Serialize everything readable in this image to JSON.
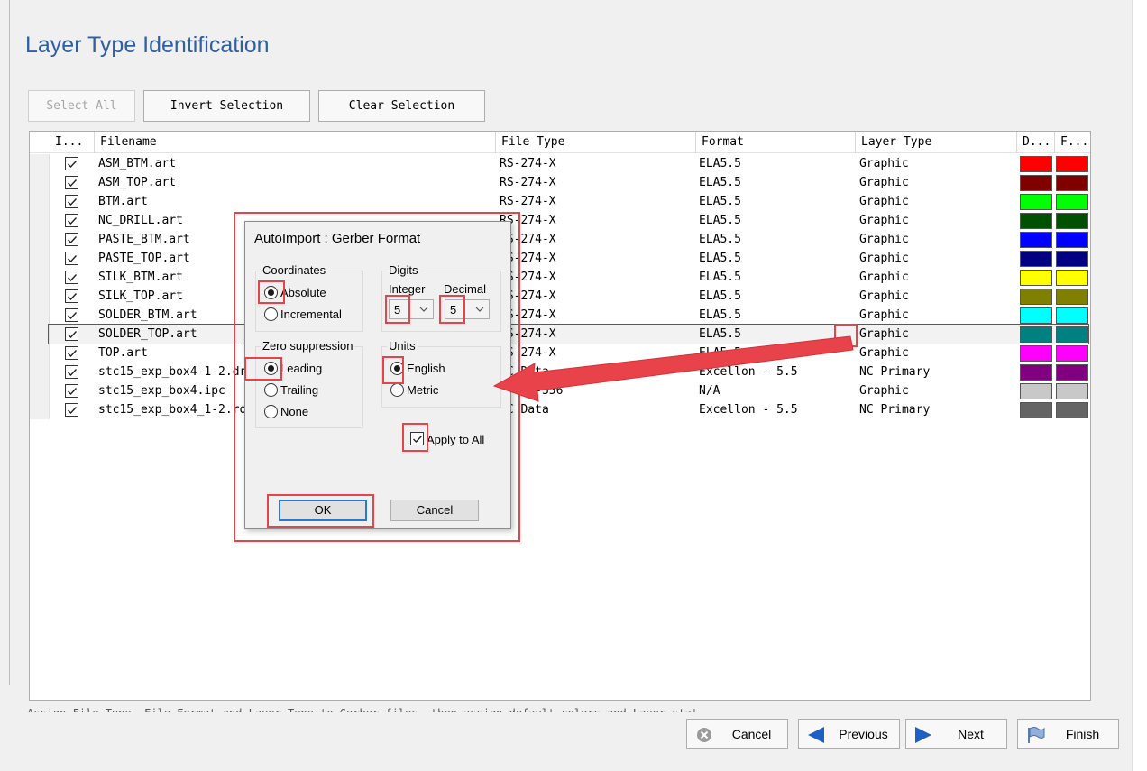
{
  "page_title": "Layer Type Identification",
  "toolbar": {
    "select_all": "Select All",
    "invert_selection": "Invert Selection",
    "clear_selection": "Clear Selection"
  },
  "columns": [
    "I...",
    "Filename",
    "File Type",
    "Format",
    "Layer Type",
    "D...",
    "F..."
  ],
  "rows": [
    {
      "filename": "ASM_BTM.art",
      "file_type": "RS-274-X",
      "format": "ELA5.5",
      "layer_type": "Graphic",
      "color": "#ff0000"
    },
    {
      "filename": "ASM_TOP.art",
      "file_type": "RS-274-X",
      "format": "ELA5.5",
      "layer_type": "Graphic",
      "color": "#800000"
    },
    {
      "filename": "BTM.art",
      "file_type": "RS-274-X",
      "format": "ELA5.5",
      "layer_type": "Graphic",
      "color": "#00ff00"
    },
    {
      "filename": "NC_DRILL.art",
      "file_type": "RS-274-X",
      "format": "ELA5.5",
      "layer_type": "Graphic",
      "color": "#005000"
    },
    {
      "filename": "PASTE_BTM.art",
      "file_type": "RS-274-X",
      "format": "ELA5.5",
      "layer_type": "Graphic",
      "color": "#0000ff"
    },
    {
      "filename": "PASTE_TOP.art",
      "file_type": "RS-274-X",
      "format": "ELA5.5",
      "layer_type": "Graphic",
      "color": "#000080"
    },
    {
      "filename": "SILK_BTM.art",
      "file_type": "RS-274-X",
      "format": "ELA5.5",
      "layer_type": "Graphic",
      "color": "#ffff00"
    },
    {
      "filename": "SILK_TOP.art",
      "file_type": "RS-274-X",
      "format": "ELA5.5",
      "layer_type": "Graphic",
      "color": "#808000"
    },
    {
      "filename": "SOLDER_BTM.art",
      "file_type": "RS-274-X",
      "format": "ELA5.5",
      "layer_type": "Graphic",
      "color": "#00ffff"
    },
    {
      "filename": "SOLDER_TOP.art",
      "file_type": "RS-274-X",
      "format": "ELA5.5",
      "layer_type": "Graphic",
      "color": "#008080"
    },
    {
      "filename": "TOP.art",
      "file_type": "RS-274-X",
      "format": "ELA5.5",
      "layer_type": "Graphic",
      "color": "#ff00ff"
    },
    {
      "filename": "stc15_exp_box4-1-2.drl",
      "file_type": "NC Data",
      "format": "Excellon - 5.5",
      "layer_type": "NC Primary",
      "color": "#800080"
    },
    {
      "filename": "stc15_exp_box4.ipc",
      "file_type": "IPC-D-356",
      "format": "N/A",
      "layer_type": "Graphic",
      "color": "#c8c8c8"
    },
    {
      "filename": "stc15_exp_box4_1-2.rou",
      "file_type": "NC Data",
      "format": "Excellon - 5.5",
      "layer_type": "NC Primary",
      "color": "#646464"
    }
  ],
  "status_text": "Assign File Type, File Format and Layer Type to Gerber files, then assign default colors and Layer stat...",
  "wizard": {
    "cancel": "Cancel",
    "previous": "Previous",
    "next": "Next",
    "finish": "Finish"
  },
  "dialog": {
    "title": "AutoImport : Gerber Format",
    "coordinates": {
      "label": "Coordinates",
      "absolute": "Absolute",
      "incremental": "Incremental",
      "selected": "absolute"
    },
    "digits": {
      "label": "Digits",
      "integer_label": "Integer",
      "integer_value": "5",
      "decimal_label": "Decimal",
      "decimal_value": "5"
    },
    "zero_suppression": {
      "label": "Zero suppression",
      "leading": "Leading",
      "trailing": "Trailing",
      "none": "None",
      "selected": "leading"
    },
    "units": {
      "label": "Units",
      "english": "English",
      "metric": "Metric",
      "selected": "english"
    },
    "apply_to_all": "Apply to All",
    "ok": "OK",
    "cancel": "Cancel"
  },
  "colors": {
    "title": "#2f5fa4",
    "highlight": "#e8424a",
    "selection_outline": "#2d5fb0"
  }
}
